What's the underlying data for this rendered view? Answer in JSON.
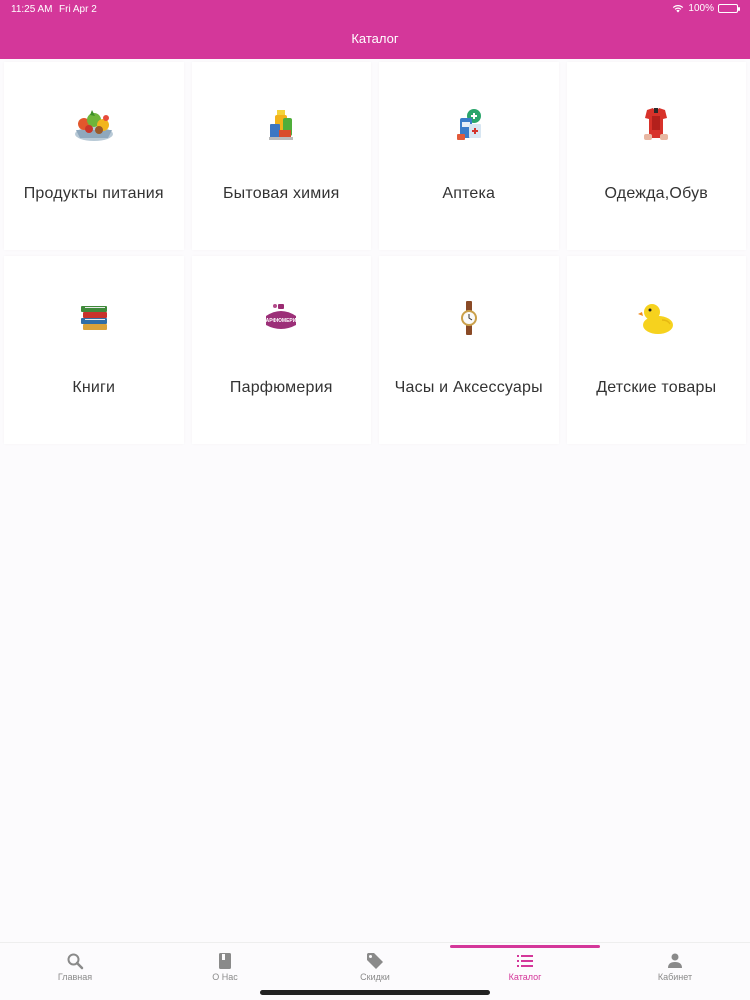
{
  "status": {
    "time": "11:25 AM",
    "date": "Fri Apr 2",
    "battery": "100%"
  },
  "header": {
    "title": "Каталог",
    "color": "#d4379a"
  },
  "categories": [
    {
      "label": "Продукты питания",
      "icon": "groceries-icon"
    },
    {
      "label": "Бытовая химия",
      "icon": "household-chemicals-icon"
    },
    {
      "label": "Аптека",
      "icon": "pharmacy-icon"
    },
    {
      "label": "Одежда,Обув",
      "icon": "clothing-icon"
    },
    {
      "label": "Книги",
      "icon": "books-icon"
    },
    {
      "label": "Парфюмерия",
      "icon": "perfume-icon",
      "icon_text": "ПАРФЮМЕРИЯ"
    },
    {
      "label": "Часы и Аксессуары",
      "icon": "watch-icon"
    },
    {
      "label": "Детские товары",
      "icon": "rubber-duck-icon"
    }
  ],
  "tabs": [
    {
      "label": "Главная",
      "icon": "search-icon",
      "active": false
    },
    {
      "label": "О Нас",
      "icon": "book-icon",
      "active": false
    },
    {
      "label": "Скидки",
      "icon": "tag-icon",
      "active": false
    },
    {
      "label": "Каталог",
      "icon": "list-icon",
      "active": true
    },
    {
      "label": "Кабинет",
      "icon": "person-icon",
      "active": false
    }
  ],
  "accent": "#d4379a"
}
